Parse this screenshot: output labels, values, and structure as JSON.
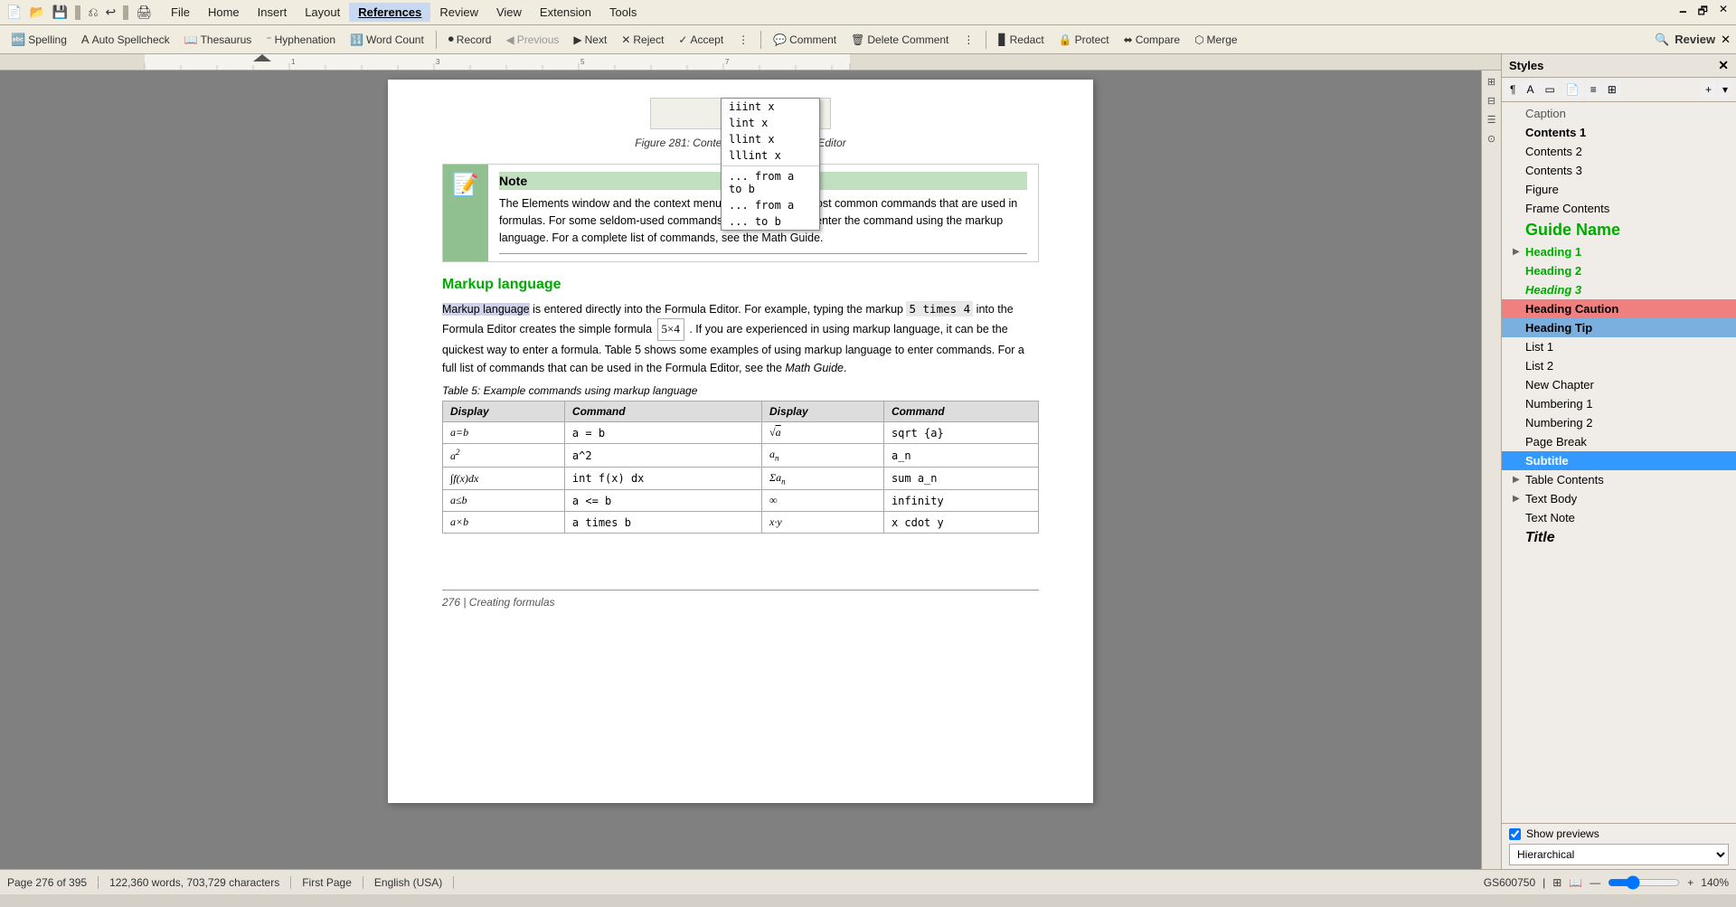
{
  "menubar": {
    "icons": [
      "📄",
      "📂",
      "💾",
      "✂️",
      "⎌",
      "↩"
    ],
    "items": [
      "File",
      "Home",
      "Insert",
      "Layout",
      "References",
      "Review",
      "View",
      "Extension",
      "Tools"
    ],
    "active": "References",
    "window_controls": [
      "🗕",
      "🗗",
      "✕"
    ]
  },
  "toolbar": {
    "spelling": "Spelling",
    "spellcheck": "Auto Spellcheck",
    "thesaurus": "Thesaurus",
    "hyphenation": "Hyphenation",
    "word_count": "Word Count",
    "record": "Record",
    "previous": "Previous",
    "next": "Next",
    "reject": "Reject",
    "accept": "Accept",
    "comment": "Comment",
    "delete_comment": "Delete Comment",
    "redact": "Redact",
    "protect": "Protect",
    "compare": "Compare",
    "merge": "Merge",
    "review_label": "Review"
  },
  "figure": {
    "caption": "Figure 281: Context menu in Formula Editor",
    "menu_items": [
      "iiint x",
      "lint x",
      "llint x",
      "lllint x",
      "... from a to b",
      "... from a",
      "... to b"
    ]
  },
  "note": {
    "title": "Note",
    "text": "The Elements window and the context menu contain only the most common commands that are used in formulas. For some seldom-used commands, you must always enter the command using the markup language. For a complete list of commands, see the Math Guide."
  },
  "content": {
    "section_heading": "Markup language",
    "para1": "Markup language is entered directly into the Formula Editor. For example, typing the markup 5 times 4 into the Formula Editor creates the simple formula",
    "formula_display": "5×4",
    "para1b": ". If you are experienced in using markup language, it can be the quickest way to enter a formula. Table 5 shows some examples of using markup language to enter commands. For a full list of commands that can be used in the Formula Editor, see the Math Guide.",
    "table_caption": "Table 5: Example commands using markup language",
    "table_headers": [
      "Display",
      "Command",
      "Display",
      "Command"
    ],
    "table_rows": [
      {
        "d1": "a=b",
        "c1": "a = b",
        "d2": "√a",
        "c2": "sqrt {a}"
      },
      {
        "d1": "a²",
        "c1": "a^2",
        "d2": "aₙ",
        "c2": "a_n"
      },
      {
        "d1": "∫f(x)dx",
        "c1": "int f(x) dx",
        "d2": "Σaₙ",
        "c2": "sum a_n"
      },
      {
        "d1": "a≤b",
        "c1": "a <= b",
        "d2": "∞",
        "c2": "infinity"
      },
      {
        "d1": "a×b",
        "c1": "a times b",
        "d2": "x·y",
        "c2": "x cdot y"
      }
    ],
    "page_footer": "276 | Creating formulas"
  },
  "styles_panel": {
    "title": "Styles",
    "items": [
      {
        "label": "Caption",
        "class": "style-caption",
        "expand": false
      },
      {
        "label": "Contents 1",
        "class": "style-contents1",
        "expand": false
      },
      {
        "label": "Contents 2",
        "class": "style-contents2",
        "expand": false
      },
      {
        "label": "Contents 3",
        "class": "style-contents3",
        "expand": false
      },
      {
        "label": "Figure",
        "class": "style-figure",
        "expand": false
      },
      {
        "label": "Frame Contents",
        "class": "style-frame-contents",
        "expand": false
      },
      {
        "label": "Guide Name",
        "class": "style-guide-name",
        "expand": false
      },
      {
        "label": "Heading 1",
        "class": "style-heading1",
        "expand": true
      },
      {
        "label": "Heading 2",
        "class": "style-heading2",
        "expand": false
      },
      {
        "label": "Heading 3",
        "class": "style-heading3",
        "expand": false
      },
      {
        "label": "Heading Caution",
        "class": "style-heading-caution",
        "expand": false
      },
      {
        "label": "Heading Tip",
        "class": "style-heading-tip",
        "expand": false
      },
      {
        "label": "List 1",
        "class": "style-list1",
        "expand": false
      },
      {
        "label": "List 2",
        "class": "style-list2",
        "expand": false
      },
      {
        "label": "New Chapter",
        "class": "style-new-chapter",
        "expand": false
      },
      {
        "label": "Numbering 1",
        "class": "style-numbering1",
        "expand": false
      },
      {
        "label": "Numbering 2",
        "class": "style-numbering2",
        "expand": false
      },
      {
        "label": "Page Break",
        "class": "style-page-break",
        "expand": false
      },
      {
        "label": "Subtitle",
        "class": "style-subtitle",
        "selected": true,
        "expand": false
      },
      {
        "label": "Table Contents",
        "class": "style-table-contents",
        "expand": true
      },
      {
        "label": "Text Body",
        "class": "style-text-body",
        "expand": true
      },
      {
        "label": "Text Note",
        "class": "style-text-note",
        "expand": false
      },
      {
        "label": "Title",
        "class": "style-title",
        "expand": false
      }
    ],
    "show_previews": "Show previews",
    "hierarchical": "Hierarchical"
  },
  "status_bar": {
    "page_info": "Page 276 of 395",
    "word_count": "122,360 words, 703,729 characters",
    "section": "First Page",
    "language": "English (USA)",
    "position": "GS600750",
    "zoom": "140%"
  }
}
